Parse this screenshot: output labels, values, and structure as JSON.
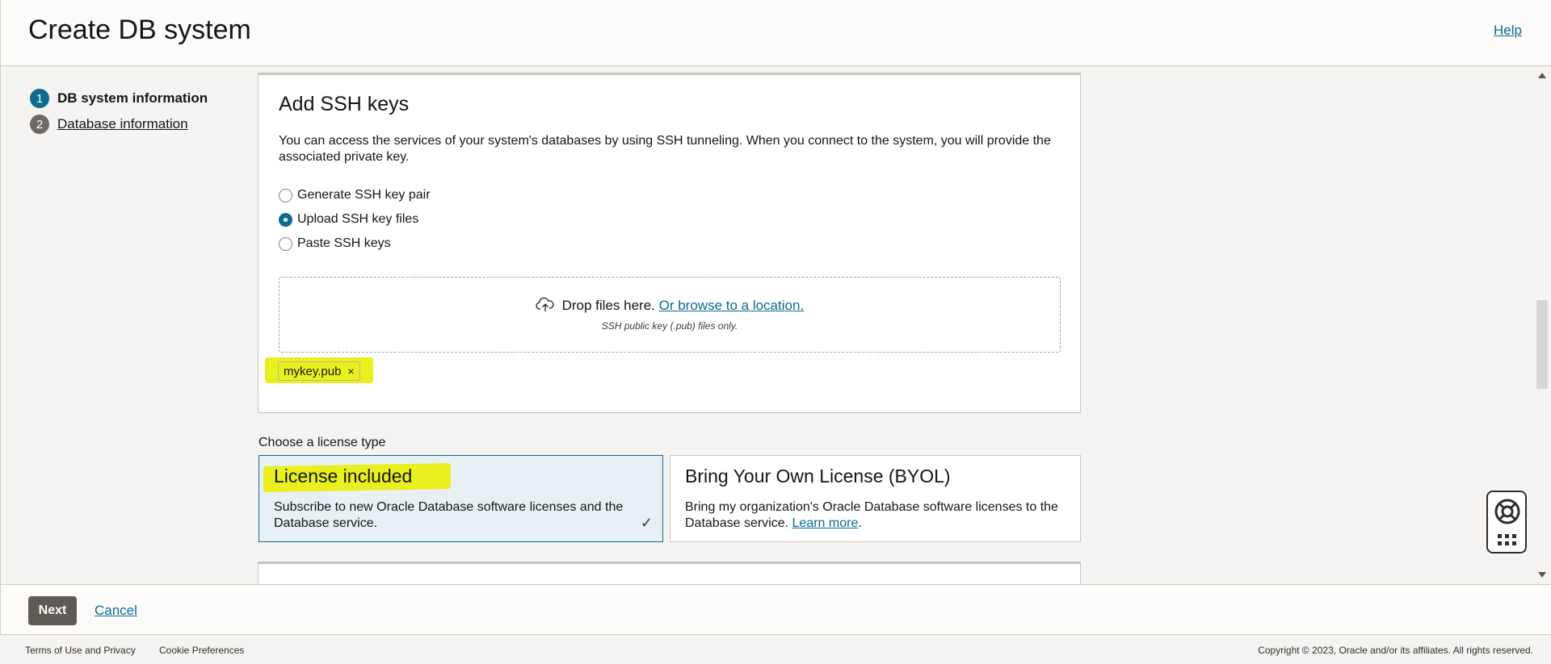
{
  "header": {
    "title": "Create DB system",
    "help_label": "Help"
  },
  "steps": [
    {
      "number": "1",
      "label": "DB system information",
      "state": "active"
    },
    {
      "number": "2",
      "label": "Database information",
      "state": "link"
    }
  ],
  "ssh": {
    "title": "Add SSH keys",
    "description": "You can access the services of your system's databases by using SSH tunneling. When you connect to the system, you will provide the associated private key.",
    "options": [
      {
        "label": "Generate SSH key pair",
        "checked": false
      },
      {
        "label": "Upload SSH key files",
        "checked": true
      },
      {
        "label": "Paste SSH keys",
        "checked": false
      }
    ],
    "dropzone": {
      "text": "Drop files here.",
      "browse_label": "Or browse to a location.",
      "hint": "SSH public key (.pub) files only."
    },
    "uploaded_file": "mykey.pub",
    "remove_glyph": "×"
  },
  "license": {
    "label": "Choose a license type",
    "options": [
      {
        "title": "License included",
        "description": "Subscribe to new Oracle Database software licenses and the Database service.",
        "selected": true
      },
      {
        "title": "Bring Your Own License (BYOL)",
        "description": "Bring my organization's Oracle Database software licenses to the Database service.",
        "learn_more": "Learn more",
        "learn_more_suffix": ".",
        "selected": false
      }
    ],
    "check_glyph": "✓"
  },
  "actions": {
    "next_label": "Next",
    "cancel_label": "Cancel"
  },
  "footer": {
    "terms": "Terms of Use and Privacy",
    "cookies": "Cookie Preferences",
    "copyright": "Copyright © 2023, Oracle and/or its affiliates. All rights reserved."
  },
  "colors": {
    "accent": "#0d6b8f",
    "highlight": "#eaf01e",
    "primary_button": "#605a55"
  },
  "icons": [
    "upload-cloud-icon",
    "check-icon",
    "close-icon",
    "lifebuoy-icon",
    "grid-icon"
  ]
}
